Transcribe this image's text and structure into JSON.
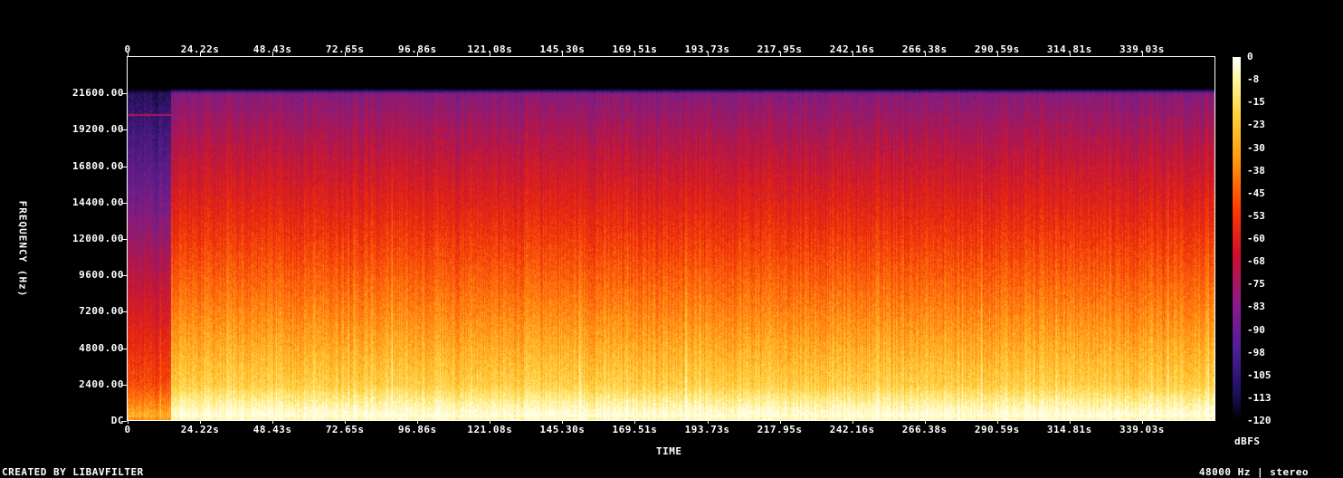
{
  "chart_data": {
    "type": "heatmap",
    "title": "",
    "xlabel": "TIME",
    "ylabel": "FREQUENCY (Hz)",
    "x_ticks": [
      "0",
      "24.22s",
      "48.43s",
      "72.65s",
      "96.86s",
      "121.08s",
      "145.30s",
      "169.51s",
      "193.73s",
      "217.95s",
      "242.16s",
      "266.38s",
      "290.59s",
      "314.81s",
      "339.03s"
    ],
    "x_tick_values": [
      0,
      24.22,
      48.43,
      72.65,
      96.86,
      121.08,
      145.3,
      169.51,
      193.73,
      217.95,
      242.16,
      266.38,
      290.59,
      314.81,
      339.03
    ],
    "xlim": [
      0,
      363.25
    ],
    "y_ticks": [
      "DC",
      "2400.00",
      "4800.00",
      "7200.00",
      "9600.00",
      "12000.00",
      "14400.00",
      "16800.00",
      "19200.00",
      "21600.00"
    ],
    "y_tick_values": [
      0,
      2400,
      4800,
      7200,
      9600,
      12000,
      14400,
      16800,
      19200,
      21600
    ],
    "ylim": [
      0,
      24000
    ],
    "colorbar": {
      "label": "dBFS",
      "ticks": [
        "0",
        "-8",
        "-15",
        "-23",
        "-30",
        "-38",
        "-45",
        "-53",
        "-60",
        "-68",
        "-75",
        "-83",
        "-90",
        "-98",
        "-105",
        "-113",
        "-120"
      ],
      "range": [
        -120,
        0
      ],
      "colors": [
        "#000000",
        "#1e1060",
        "#501e9a",
        "#8a1a8a",
        "#d0102a",
        "#ff3a00",
        "#ff9a10",
        "#ffd640",
        "#fff7a0",
        "#ffffff"
      ]
    },
    "audio_end_s": 363.25,
    "cutoff_hz": 21600,
    "intro_end_s": 14.5
  },
  "footer": {
    "left": "CREATED BY LIBAVFILTER",
    "right": "48000 Hz | stereo"
  }
}
